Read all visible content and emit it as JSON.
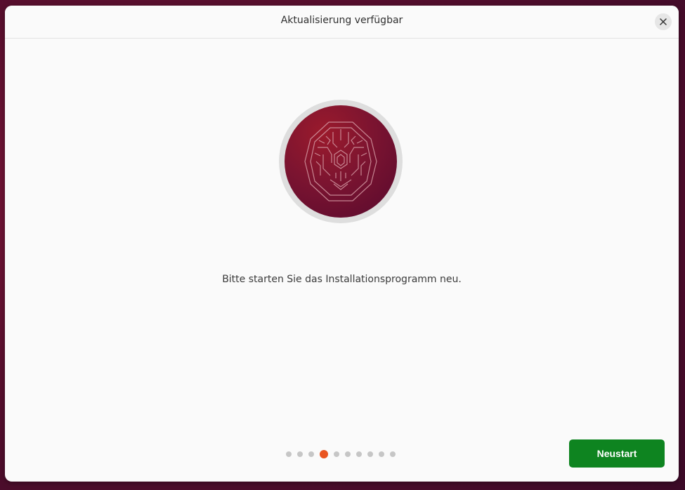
{
  "window": {
    "title": "Aktualisierung verfügbar"
  },
  "icons": {
    "close": "close-icon",
    "logo": "ubuntu-lunar-lobster-logo"
  },
  "main": {
    "message": "Bitte starten Sie das Installationsprogramm neu."
  },
  "progress": {
    "total_steps": 10,
    "current_step": 4
  },
  "actions": {
    "restart_label": "Neustart"
  },
  "colors": {
    "accent": "#e95420",
    "primary_button": "#0e8420",
    "window_background": "#fafafa",
    "desktop_background": "#5a0f2e"
  }
}
